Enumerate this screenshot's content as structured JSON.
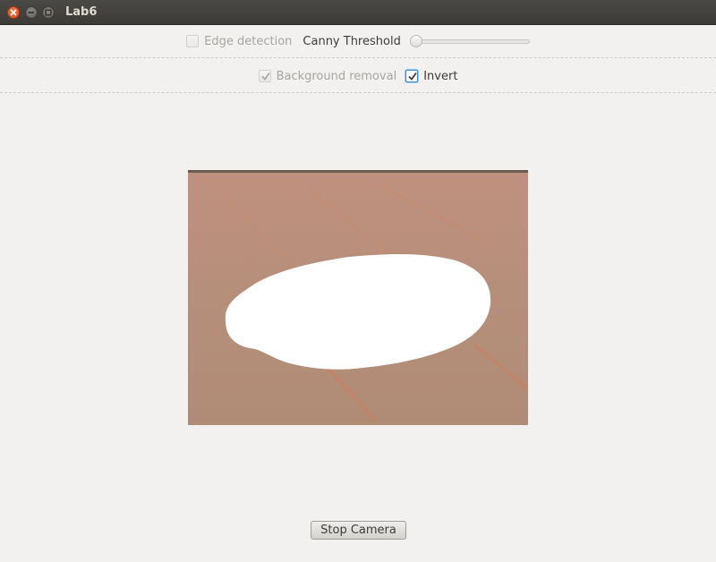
{
  "window": {
    "title": "Lab6"
  },
  "controls": {
    "edge_detection_label": "Edge detection",
    "edge_detection_checked": false,
    "canny_threshold_label": "Canny Threshold",
    "canny_threshold_value": 0,
    "background_removal_label": "Background removal",
    "background_removal_checked": true,
    "invert_label": "Invert",
    "invert_checked": true
  },
  "feed": {
    "background_color": "#b88f7b",
    "blob_color": "#ffffff"
  },
  "actions": {
    "stop_camera_label": "Stop Camera"
  }
}
